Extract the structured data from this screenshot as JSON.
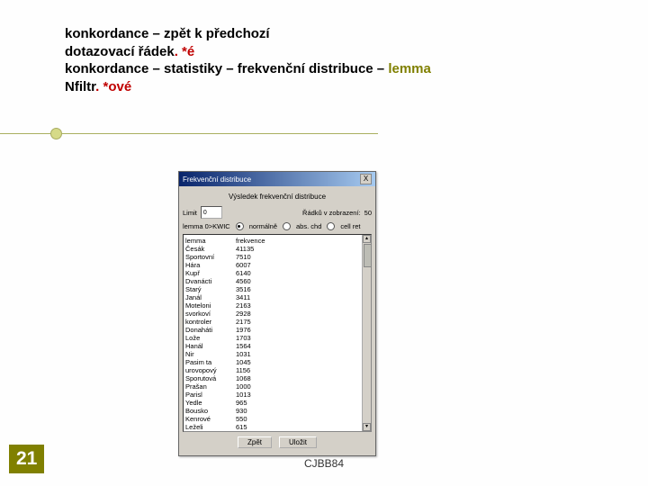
{
  "title": {
    "l1a": "konkordance – zpět k předchozí",
    "l2a": "dotazovací řádek",
    "l2b": ". *é",
    "l3a": " konkordance – statistiky – frekvenční distribuce – ",
    "l3b": "lemma",
    "l4a": "Nfiltr",
    "l4b": ". *ové"
  },
  "slide_number": "21",
  "footer": "CJBB84",
  "dialog": {
    "title": "Frekvenční distribuce",
    "close": "X",
    "caption": "Výsledek frekvenční distribuce",
    "limit_label": "Limit",
    "limit_value": "0",
    "rows_label": "Řádků v zobrazení:",
    "rows_value": "50",
    "attr_label": "lemma 0>KWIC",
    "radios": [
      {
        "label": "normálně",
        "selected": true
      },
      {
        "label": "abs. chd",
        "selected": false
      },
      {
        "label": "cell ret",
        "selected": false
      }
    ],
    "headers": [
      "lemma",
      "frekvence"
    ],
    "rows": [
      [
        "Česák",
        "41135"
      ],
      [
        "Sportovní",
        "7510"
      ],
      [
        "Hára",
        "6007"
      ],
      [
        "Kupř",
        "6140"
      ],
      [
        "Dvanácti",
        "4560"
      ],
      [
        "Starý",
        "3516"
      ],
      [
        "Janál",
        "3411"
      ],
      [
        "Moteloni",
        "2163"
      ],
      [
        "svorkoví",
        "2928"
      ],
      [
        "kontroler",
        "2175"
      ],
      [
        "Donaháti",
        "1976"
      ],
      [
        "Lože",
        "1703"
      ],
      [
        "Hanál",
        "1564"
      ],
      [
        "Nir",
        "1031"
      ],
      [
        "Pasim ta",
        "1045"
      ],
      [
        "urovopový",
        "1156"
      ],
      [
        "Sporutová",
        "1068"
      ],
      [
        "Prašan",
        "1000"
      ],
      [
        "Parisl",
        "1013"
      ],
      [
        "Yedle",
        "965"
      ],
      [
        "Bousko",
        "930"
      ],
      [
        "Kenrové",
        "550"
      ],
      [
        "Leželi",
        "615"
      ]
    ],
    "btn_back": "Zpět",
    "btn_save": "Uložit"
  }
}
